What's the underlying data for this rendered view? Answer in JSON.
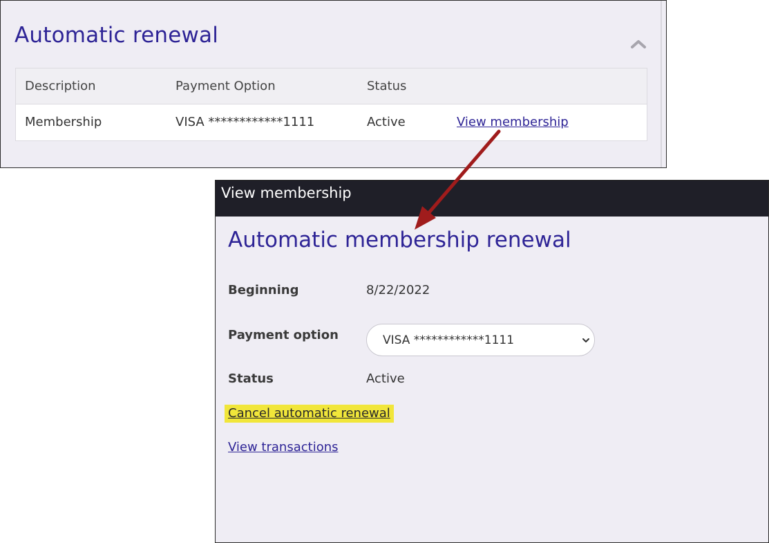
{
  "top_panel": {
    "title": "Automatic renewal",
    "table": {
      "headers": [
        "Description",
        "Payment Option",
        "Status"
      ],
      "rows": [
        {
          "description": "Membership",
          "payment_option": "VISA ************1111",
          "status": "Active",
          "action_link": "View membership"
        }
      ]
    }
  },
  "dialog": {
    "header_title": "View membership",
    "heading": "Automatic membership renewal",
    "fields": {
      "beginning_label": "Beginning",
      "beginning_value": "8/22/2022",
      "payment_option_label": "Payment option",
      "payment_option_selected": "VISA ************1111",
      "status_label": "Status",
      "status_value": "Active"
    },
    "cancel_link": "Cancel automatic renewal",
    "transactions_link": "View transactions"
  },
  "icons": {
    "collapse": "chevron-up-icon",
    "select_toggle": "chevron-down-icon",
    "callout": "arrow-annotation"
  },
  "colors": {
    "heading": "#2e2496",
    "panel_bg": "#efedf4",
    "dialog_header_bg": "#1f1f28",
    "highlight": "#f1e63a",
    "arrow": "#a01c1c"
  }
}
